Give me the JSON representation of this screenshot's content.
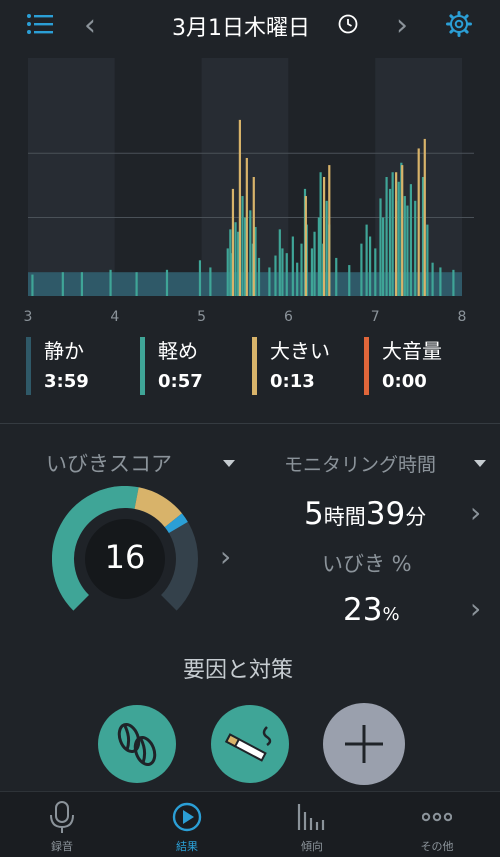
{
  "header": {
    "date_title": "3月1日木曜日",
    "back_glyph": "‹",
    "forward_glyph": "›",
    "menu_icon": "list-icon",
    "clock_icon": "clock-icon",
    "settings_icon": "gear-icon",
    "accent_color": "#2b9fd6"
  },
  "chart_data": {
    "type": "bar",
    "title": "",
    "xlabel": "",
    "ylabel": "",
    "x_ticks": [
      "3",
      "4",
      "5",
      "6",
      "7",
      "8"
    ],
    "xlim": [
      3,
      8
    ],
    "ylim": [
      0,
      1
    ],
    "grid": true,
    "series": [
      {
        "name": "軽め",
        "color": "#3fa597",
        "points": [
          [
            3.05,
            0.09
          ],
          [
            3.4,
            0.1
          ],
          [
            3.62,
            0.1
          ],
          [
            3.95,
            0.11
          ],
          [
            4.25,
            0.1
          ],
          [
            4.6,
            0.11
          ],
          [
            4.98,
            0.15
          ],
          [
            5.1,
            0.12
          ],
          [
            5.3,
            0.2
          ],
          [
            5.33,
            0.28
          ],
          [
            5.35,
            0.18
          ],
          [
            5.39,
            0.31
          ],
          [
            5.42,
            0.27
          ],
          [
            5.47,
            0.42
          ],
          [
            5.5,
            0.33
          ],
          [
            5.56,
            0.36
          ],
          [
            5.59,
            0.22
          ],
          [
            5.62,
            0.29
          ],
          [
            5.66,
            0.16
          ],
          [
            5.78,
            0.12
          ],
          [
            5.85,
            0.17
          ],
          [
            5.9,
            0.28
          ],
          [
            5.93,
            0.2
          ],
          [
            5.98,
            0.18
          ],
          [
            6.05,
            0.25
          ],
          [
            6.1,
            0.14
          ],
          [
            6.15,
            0.22
          ],
          [
            6.19,
            0.45
          ],
          [
            6.21,
            0.3
          ],
          [
            6.27,
            0.2
          ],
          [
            6.3,
            0.27
          ],
          [
            6.35,
            0.33
          ],
          [
            6.37,
            0.52
          ],
          [
            6.4,
            0.22
          ],
          [
            6.44,
            0.4
          ],
          [
            6.47,
            0.3
          ],
          [
            6.55,
            0.16
          ],
          [
            6.7,
            0.13
          ],
          [
            6.84,
            0.22
          ],
          [
            6.9,
            0.3
          ],
          [
            6.94,
            0.25
          ],
          [
            7.0,
            0.2
          ],
          [
            7.06,
            0.41
          ],
          [
            7.09,
            0.33
          ],
          [
            7.13,
            0.5
          ],
          [
            7.17,
            0.45
          ],
          [
            7.2,
            0.52
          ],
          [
            7.24,
            0.4
          ],
          [
            7.27,
            0.48
          ],
          [
            7.3,
            0.56
          ],
          [
            7.34,
            0.42
          ],
          [
            7.37,
            0.38
          ],
          [
            7.41,
            0.47
          ],
          [
            7.46,
            0.4
          ],
          [
            7.55,
            0.5
          ],
          [
            7.6,
            0.3
          ],
          [
            7.66,
            0.14
          ],
          [
            7.75,
            0.12
          ],
          [
            7.9,
            0.11
          ]
        ]
      },
      {
        "name": "大きい",
        "color": "#d8b36a",
        "points": [
          [
            5.36,
            0.45
          ],
          [
            5.44,
            0.74
          ],
          [
            5.52,
            0.58
          ],
          [
            5.6,
            0.5
          ],
          [
            6.2,
            0.42
          ],
          [
            6.41,
            0.5
          ],
          [
            6.47,
            0.55
          ],
          [
            7.24,
            0.52
          ],
          [
            7.31,
            0.55
          ],
          [
            7.5,
            0.62
          ],
          [
            7.57,
            0.66
          ]
        ]
      }
    ]
  },
  "legend": [
    {
      "label": "静か",
      "value": "3:59",
      "color": "#2f5968"
    },
    {
      "label": "軽め",
      "value": "0:57",
      "color": "#3fa597"
    },
    {
      "label": "大きい",
      "value": "0:13",
      "color": "#d8b36a"
    },
    {
      "label": "大音量",
      "value": "0:00",
      "color": "#e0663a"
    }
  ],
  "score": {
    "title": "いびきスコア",
    "value": 16,
    "value_text": "16",
    "quiet_fraction": 0.54,
    "light_fraction": 0.15,
    "loud_fraction": 0.03
  },
  "monitoring": {
    "title": "モニタリング時間",
    "hours": "5",
    "hours_unit": "時間",
    "minutes": "39",
    "minutes_unit": "分"
  },
  "snore_pct": {
    "label": "いびき %",
    "value": "23",
    "unit": "%"
  },
  "factors": {
    "title": "要因と対策",
    "buttons": [
      {
        "icon": "coffee-bean-icon"
      },
      {
        "icon": "cigarette-icon"
      },
      {
        "icon": "plus-icon"
      }
    ]
  },
  "nav": {
    "items": [
      {
        "label": "録音",
        "icon": "microphone-icon"
      },
      {
        "label": "結果",
        "icon": "play-circle-icon",
        "active": true
      },
      {
        "label": "傾向",
        "icon": "bar-chart-icon"
      },
      {
        "label": "その他",
        "icon": "more-icon"
      }
    ],
    "active_color": "#2b9fd6",
    "inactive_color": "#8b939a"
  }
}
